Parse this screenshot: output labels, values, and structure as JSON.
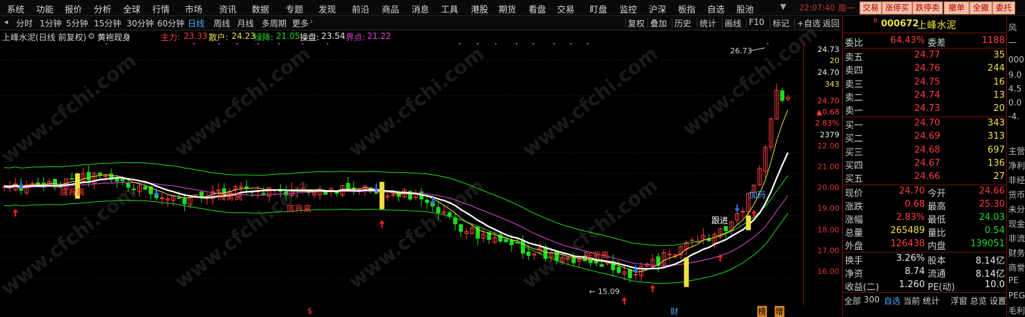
{
  "menu": {
    "items": [
      "系统",
      "功能",
      "报价",
      "分析",
      "全球",
      "行情",
      "市场",
      "资讯",
      "数据",
      "专题",
      "发现",
      "前沿",
      "商品",
      "消息",
      "工具",
      "港股",
      "期货",
      "看盘",
      "交易",
      "盯盘",
      "监控",
      "沪深",
      "板指",
      "自选",
      "股池"
    ],
    "time": "22:07:40",
    "weekday": "周一",
    "quick_buttons": [
      "交易",
      "涨停买",
      "跌停卖",
      "撤单",
      "全撤",
      "委托"
    ],
    "colors": {
      "accent": "#c83232",
      "quick_bg": "#f2c0a8"
    }
  },
  "toolbar": {
    "periods": [
      "分时",
      "1分钟",
      "5分钟",
      "15分钟",
      "30分钟",
      "60分钟",
      "日线",
      "周线",
      "月线",
      "多周期",
      "更多"
    ],
    "active_period": "日线",
    "right_buttons": [
      "复权",
      "叠加",
      "历史",
      "统计",
      "画线",
      "F10",
      "标记",
      "+自选",
      "返回"
    ]
  },
  "info": {
    "title": "上峰水泥(日线 前复权)",
    "indicator": "黄袍现身",
    "zhuli_label": "主力:",
    "zhuli": "23.33",
    "sanhu_label": "散户:",
    "sanhu": "24.23",
    "lujiang_label": "绿降:",
    "lujiang": "21.05",
    "caopan_label": "操盘:",
    "caopan": "23.54",
    "jiedian_label": "界点:",
    "jiedian": "21.22"
  },
  "chart": {
    "annotations": {
      "high": "26.73",
      "low": "15.09",
      "di_beili": "底背离",
      "genjin": "跟进",
      "jiama": "加码"
    },
    "bottom_marks": [
      "$",
      "财",
      "榜",
      "增"
    ]
  },
  "yaxis": {
    "labels": [
      "24.73",
      "20",
      "24.70",
      "343",
      "24.70",
      "▲0.68",
      "2.83%",
      "2379",
      "22.00",
      "21.00",
      "20.00",
      "19.00",
      "18.00",
      "17.00",
      "16.00"
    ]
  },
  "chart_data": {
    "type": "candlestick",
    "title": "",
    "ylim": [
      15,
      27
    ],
    "price_levels": [
      22,
      21,
      20,
      19,
      18,
      17,
      16
    ],
    "high_annotation": 26.73,
    "low_annotation": 15.09,
    "last_close": 24.7
  },
  "panel": {
    "code": "000672",
    "name": "上峰水泥",
    "weibi_label": "委比",
    "weibi": "64.43%",
    "weicha_label": "委差",
    "weicha": "1188",
    "asks": [
      {
        "label": "卖五",
        "price": "24.77",
        "vol": "35"
      },
      {
        "label": "卖四",
        "price": "24.76",
        "vol": "244"
      },
      {
        "label": "卖三",
        "price": "24.75",
        "vol": "16"
      },
      {
        "label": "卖二",
        "price": "24.74",
        "vol": "13"
      },
      {
        "label": "卖一",
        "price": "24.73",
        "vol": "20"
      }
    ],
    "bids": [
      {
        "label": "买一",
        "price": "24.70",
        "vol": "343"
      },
      {
        "label": "买二",
        "price": "24.69",
        "vol": "313"
      },
      {
        "label": "买三",
        "price": "24.68",
        "vol": "697"
      },
      {
        "label": "买四",
        "price": "24.67",
        "vol": "136"
      },
      {
        "label": "买五",
        "price": "24.66",
        "vol": "27"
      }
    ],
    "stats": [
      {
        "l1": "现价",
        "v1": "24.70",
        "l2": "今开",
        "v2": "24.66"
      },
      {
        "l1": "涨跌",
        "v1": "0.68",
        "l2": "最高",
        "v2": "25.30"
      },
      {
        "l1": "涨幅",
        "v1": "2.83%",
        "l2": "最低",
        "v2": "24.03"
      },
      {
        "l1": "总量",
        "v1": "265489",
        "l2": "量比",
        "v2": "0.54"
      },
      {
        "l1": "外盘",
        "v1": "126438",
        "l2": "内盘",
        "v2": "139051"
      }
    ],
    "stats2": [
      {
        "l1": "换手",
        "v1": "3.26%",
        "l2": "股本",
        "v2": "8.14亿"
      },
      {
        "l1": "净资",
        "v1": "8.74",
        "l2": "流通",
        "v2": "8.14亿"
      },
      {
        "l1": "收益(二)",
        "v1": "1.260",
        "l2": "PE(动)",
        "v2": "10.0"
      }
    ],
    "bottom_tabs": [
      "全部",
      "300",
      "自选",
      "当前",
      "统计",
      "浮窗",
      "总览",
      "设置"
    ]
  },
  "farright": {
    "items": [
      "风",
      "一",
      "000",
      "9.0",
      "4.5",
      "0.0",
      "-4.",
      "主营",
      "净利",
      "非经",
      "货币",
      "未分",
      "现金",
      "非流",
      "财务",
      "商誉",
      "PE",
      "PEG",
      "毛利"
    ]
  },
  "watermark": "www.cfchi.com"
}
